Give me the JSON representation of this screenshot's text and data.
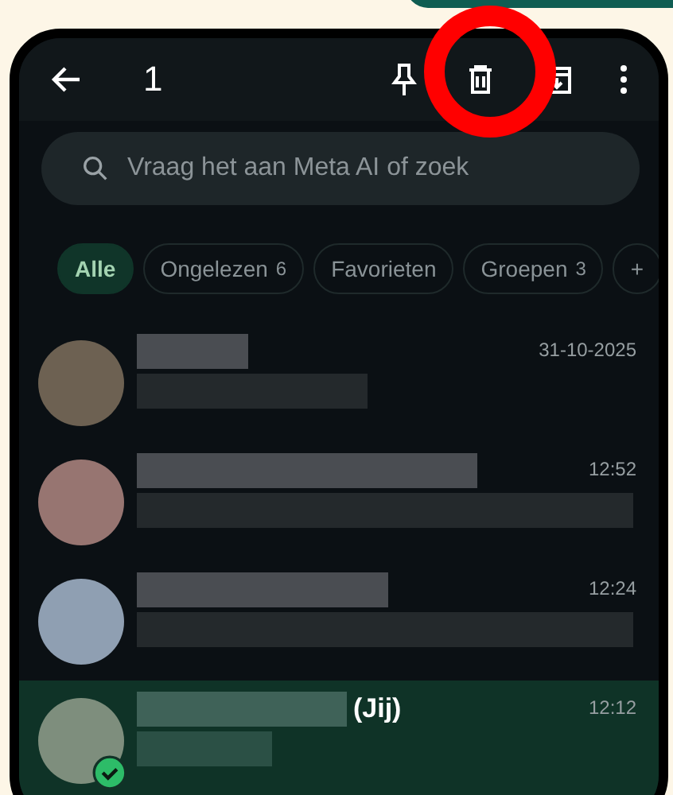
{
  "header": {
    "selected_count": "1"
  },
  "search": {
    "placeholder": "Vraag het aan Meta AI of zoek"
  },
  "filters": [
    {
      "label": "Alle",
      "selected": true
    },
    {
      "label": "Ongelezen",
      "count": "6",
      "selected": false
    },
    {
      "label": "Favorieten",
      "selected": false
    },
    {
      "label": "Groepen",
      "count": "3",
      "selected": false
    },
    {
      "label": "+",
      "selected": false
    }
  ],
  "chats": [
    {
      "time": "31-10-2025",
      "color": "#6e6150",
      "selected": false
    },
    {
      "time": "12:52",
      "color": "#9a7470",
      "selected": false
    },
    {
      "time": "12:24",
      "color": "#8e9fb4",
      "selected": false
    },
    {
      "time": "12:12",
      "self_label": "(Jij)",
      "color": "#7d8f7c",
      "selected": true
    }
  ]
}
